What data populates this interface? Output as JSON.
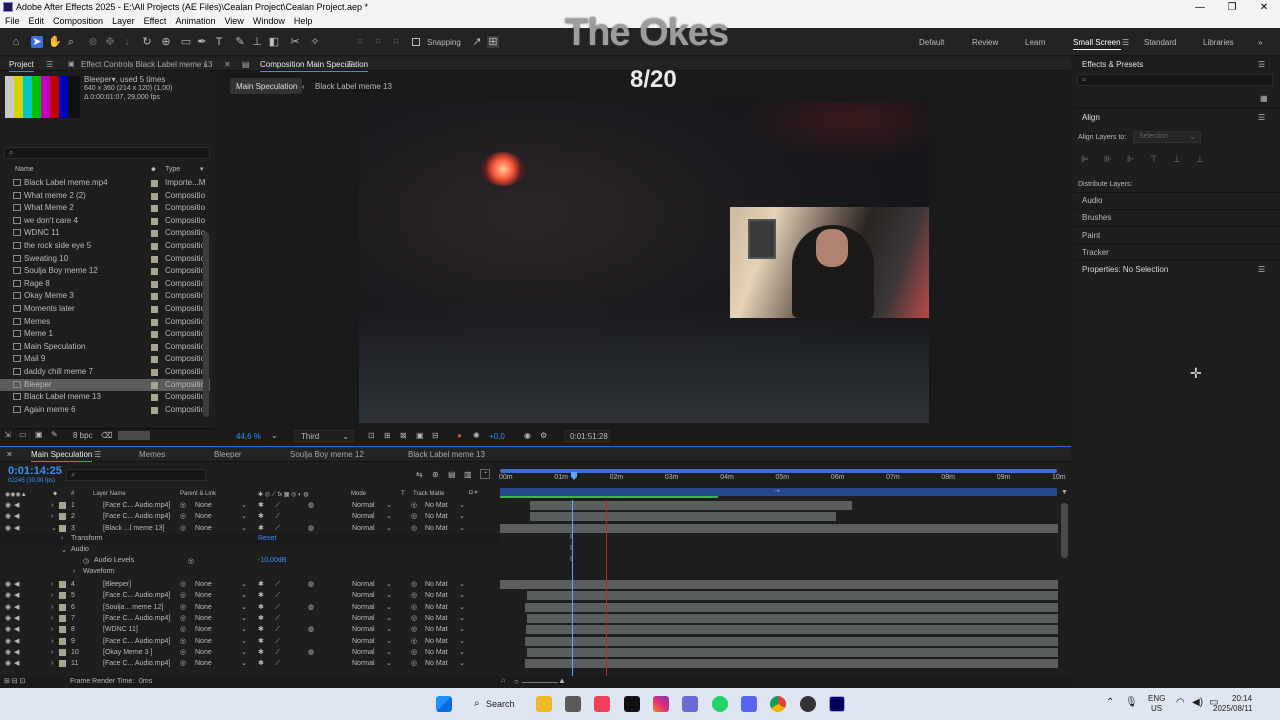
{
  "window": {
    "title": "Adobe After Effects 2025 - E:\\All Projects (AE Files)\\Cealan Project\\Cealan Project.aep *",
    "controls": [
      "—",
      "❐",
      "✕"
    ]
  },
  "menu": [
    "File",
    "Edit",
    "Composition",
    "Layer",
    "Effect",
    "Animation",
    "View",
    "Window",
    "Help"
  ],
  "overlay": {
    "title": "The Okes",
    "counter": "8/20"
  },
  "toolbar": {
    "snapping_label": "Snapping",
    "workspaces": [
      "Default",
      "Review",
      "Learn",
      "Small Screen",
      "Standard",
      "Libraries"
    ],
    "active_workspace": "Small Screen"
  },
  "project_panel": {
    "tab_project": "Project",
    "tab_effect_controls": "Effect Controls Black Label meme 13",
    "selected_name": "Bleeper",
    "used_times": ", used 5 times",
    "dimensions": "640 x 360  (214 x 120) (1,00)",
    "duration": "Δ 0:00:01:07, 29,000 fps",
    "col_name": "Name",
    "col_type": "Type",
    "items": [
      {
        "name": "Black Label meme.mp4",
        "type": "Importe...M"
      },
      {
        "name": "What meme 2 (2)",
        "type": "Compositio"
      },
      {
        "name": "What Meme 2",
        "type": "Compositio"
      },
      {
        "name": "we don't care 4",
        "type": "Compositio"
      },
      {
        "name": "WDNC 11",
        "type": "Compositio"
      },
      {
        "name": "the rock side eye 5",
        "type": "Compositio"
      },
      {
        "name": "Sweating 10",
        "type": "Compositio"
      },
      {
        "name": "Soulja Boy meme 12",
        "type": "Compositio"
      },
      {
        "name": "Rage 8",
        "type": "Compositio"
      },
      {
        "name": "Okay Meme 3",
        "type": "Compositio"
      },
      {
        "name": "Moments later",
        "type": "Compositio"
      },
      {
        "name": "Memes",
        "type": "Compositio"
      },
      {
        "name": "Meme 1",
        "type": "Compositio"
      },
      {
        "name": "Main Speculation",
        "type": "Compositio"
      },
      {
        "name": "Mail 9",
        "type": "Compositio"
      },
      {
        "name": "daddy chill meme 7",
        "type": "Compositio"
      },
      {
        "name": "Bleeper",
        "type": "Compositio"
      },
      {
        "name": "Black Label meme 13",
        "type": "Compositio"
      },
      {
        "name": "Again meme 6",
        "type": "Compositio"
      }
    ],
    "bpc": "8 bpc"
  },
  "composition_panel": {
    "tab": "Composition Main Speculation",
    "breadcrumb": [
      "Main Speculation",
      "Black Label meme 13"
    ],
    "zoom": "44,6 %",
    "resolution": "Third",
    "exposure": "+0,0",
    "timecode": "0:01:51:28"
  },
  "right_panel": {
    "effects_presets": "Effects & Presets",
    "search_placeholder": "",
    "align": "Align",
    "align_to_label": "Align Layers to:",
    "align_to_value": "Selection",
    "distribute": "Distribute Layers:",
    "sections": [
      "Audio",
      "Brushes",
      "Paint",
      "Tracker"
    ],
    "properties": "Properties: No Selection"
  },
  "timeline": {
    "tabs": [
      "Main Speculation",
      "Memes",
      "Bleeper",
      "Soulja Boy meme 12",
      "Black Label meme 13"
    ],
    "timecode": "0:01:14:25",
    "timecode_sub": "02245 (30.00 fps)",
    "headers": {
      "num": "#",
      "layer_name": "Layer Name",
      "parent": "Parent & Link",
      "mode": "Mode",
      "t": "T",
      "track_matte": "Track Matte"
    },
    "ruler": [
      "00m",
      "01m",
      "02m",
      "03m",
      "04m",
      "05m",
      "06m",
      "07m",
      "08m",
      "09m",
      "10m"
    ],
    "layers_top": [
      {
        "num": "1",
        "name": "[Face C... Audio.mp4]",
        "parent": "None",
        "mode": "Normal",
        "matte": "No Mat"
      },
      {
        "num": "2",
        "name": "[Face C... Audio.mp4]",
        "parent": "None",
        "mode": "Normal",
        "matte": "No Mat"
      },
      {
        "num": "3",
        "name": "[Black ...l meme 13]",
        "parent": "None",
        "mode": "Normal",
        "matte": "No Mat"
      }
    ],
    "props": {
      "transform": "Transform",
      "reset": "Reset",
      "audio": "Audio",
      "audio_levels": "Audio Levels",
      "audio_levels_value": "-10,00dB",
      "waveform": "Waveform"
    },
    "layers_bottom": [
      {
        "num": "4",
        "name": "[Bleeper]",
        "parent": "None",
        "mode": "Normal",
        "matte": "No Mat"
      },
      {
        "num": "5",
        "name": "[Face C... Audio.mp4]",
        "parent": "None",
        "mode": "Normal",
        "matte": "No Mat"
      },
      {
        "num": "6",
        "name": "[Soulja... meme 12]",
        "parent": "None",
        "mode": "Normal",
        "matte": "No Mat"
      },
      {
        "num": "7",
        "name": "[Face C... Audio.mp4]",
        "parent": "None",
        "mode": "Normal",
        "matte": "No Mat"
      },
      {
        "num": "8",
        "name": "[WDNC 11]",
        "parent": "None",
        "mode": "Normal",
        "matte": "No Mat"
      },
      {
        "num": "9",
        "name": "[Face C... Audio.mp4]",
        "parent": "None",
        "mode": "Normal",
        "matte": "No Mat"
      },
      {
        "num": "10",
        "name": "[Okay Meme 3 ]",
        "parent": "None",
        "mode": "Normal",
        "matte": "No Mat"
      },
      {
        "num": "11",
        "name": "[Face C... Audio.mp4]",
        "parent": "None",
        "mode": "Normal",
        "matte": "No Mat"
      }
    ],
    "frame_render": "Frame Render Time:",
    "frame_render_value": "0ms"
  },
  "taskbar": {
    "search": "Search",
    "lang_top": "ENG",
    "lang_bottom": "US",
    "time": "20:14",
    "date": "2025/08/11"
  },
  "colors": {
    "accent": "#3b8ef5",
    "playhead": "#5aa5ff",
    "label_swatch": "#a7a48f",
    "red_marker": "#c0262d"
  }
}
